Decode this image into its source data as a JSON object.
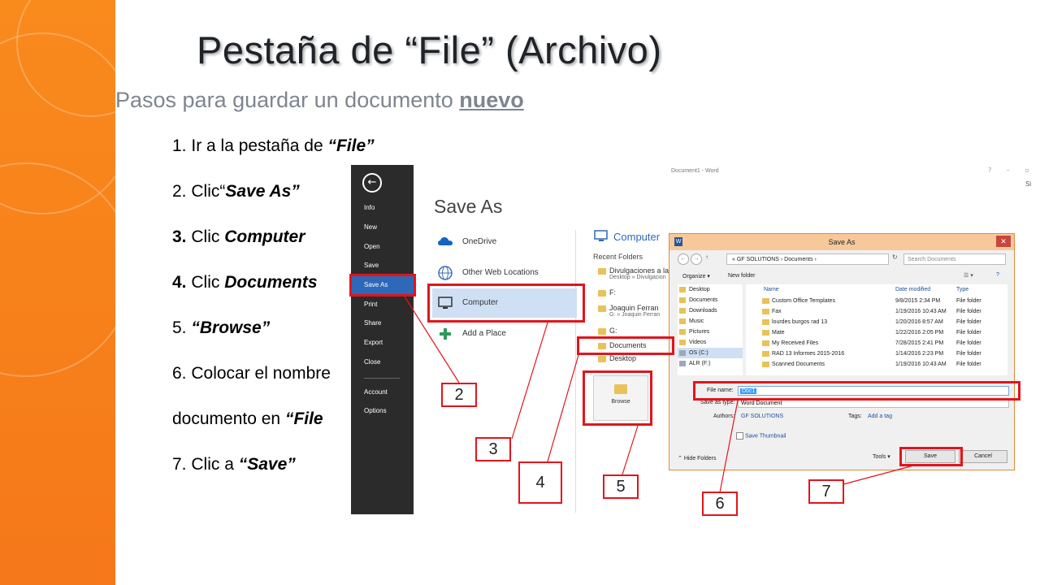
{
  "slide": {
    "title": "Pestaña de “File” (Archivo)",
    "subtitle_prefix": "Pasos para guardar un documento ",
    "subtitle_emph": "nuevo",
    "steps": [
      {
        "num": "1.",
        "text": "Ir a la pestaña de ",
        "emph": "“File”"
      },
      {
        "num": "2.",
        "text": "Clic“",
        "emph": "Save As”"
      },
      {
        "num": "3.",
        "text": "Clic ",
        "emph": "Computer"
      },
      {
        "num": "4.",
        "text": "Clic ",
        "emph": "Documents"
      },
      {
        "num": "5.",
        "text": "",
        "emph": "“Browse”"
      },
      {
        "num": "6.",
        "text": "Colocar el nombre",
        "emph": ""
      },
      {
        "num": "",
        "text": "documento en ",
        "emph": "“File"
      },
      {
        "num": "7.",
        "text": "Clic a ",
        "emph": "“Save”"
      }
    ],
    "callouts": [
      "2",
      "3",
      "4",
      "5",
      "6",
      "7"
    ]
  },
  "backstage": {
    "items": [
      "Info",
      "New",
      "Open",
      "Save",
      "Save As",
      "Print",
      "Share",
      "Export",
      "Close",
      "Account",
      "Options"
    ],
    "selected": "Save As"
  },
  "save_as": {
    "title": "Save As",
    "places": [
      "OneDrive",
      "Other Web Locations",
      "Computer",
      "Add a Place"
    ],
    "computer_heading": "Computer",
    "recent_heading": "Recent Folders",
    "folders": [
      {
        "name": "Divulgaciones a la",
        "path": "Desktop » Divulgacion"
      },
      {
        "name": "F:",
        "path": ""
      },
      {
        "name": "Joaquin Ferran",
        "path": "G: » Joaquin Ferran"
      },
      {
        "name": "G:",
        "path": ""
      },
      {
        "name": "Documents",
        "path": ""
      },
      {
        "name": "Desktop",
        "path": ""
      }
    ],
    "browse_label": "Browse",
    "window_title": "Document1 - Word",
    "window_controls": "? – ▫",
    "signin": "Si"
  },
  "dialog": {
    "title": "Save As",
    "close": "✕",
    "address": "« GF SOLUTIONS › Documents ›",
    "search_placeholder": "Search Documents",
    "organize": "Organize ▾",
    "new_folder": "New folder",
    "tree": [
      "Desktop",
      "Documents",
      "Downloads",
      "Music",
      "Pictures",
      "Videos",
      "OS (C:)",
      "ALR (F:)"
    ],
    "columns": [
      "Name",
      "Date modified",
      "Type"
    ],
    "files": [
      {
        "name": "Custom Office Templates",
        "date": "9/8/2015 2:34 PM",
        "type": "File folder"
      },
      {
        "name": "Fax",
        "date": "1/19/2016 10:43 AM",
        "type": "File folder"
      },
      {
        "name": "lourdes burgos rad 13",
        "date": "1/20/2016 8:57 AM",
        "type": "File folder"
      },
      {
        "name": "Mate",
        "date": "1/22/2016 2:05 PM",
        "type": "File folder"
      },
      {
        "name": "My Received Files",
        "date": "7/28/2015 2:41 PM",
        "type": "File folder"
      },
      {
        "name": "RAD 13 Informes 2015-2016",
        "date": "1/14/2016 2:23 PM",
        "type": "File folder"
      },
      {
        "name": "Scanned Documents",
        "date": "1/19/2016 10:43 AM",
        "type": "File folder"
      }
    ],
    "file_name_label": "File name:",
    "file_name_value": "Doc1",
    "save_type_label": "Save as type:",
    "save_type_value": "Word Document",
    "authors_label": "Authors:",
    "authors_value": "GF SOLUTIONS",
    "tags_label": "Tags:",
    "tags_value": "Add a tag",
    "thumbnail_label": "Save Thumbnail",
    "hide_folders": "Hide Folders",
    "tools": "Tools ▾",
    "save": "Save",
    "cancel": "Cancel"
  },
  "colors": {
    "accent_orange": "#f5781a",
    "annotation_red": "#e3141c",
    "word_blue": "#2e68b8"
  }
}
